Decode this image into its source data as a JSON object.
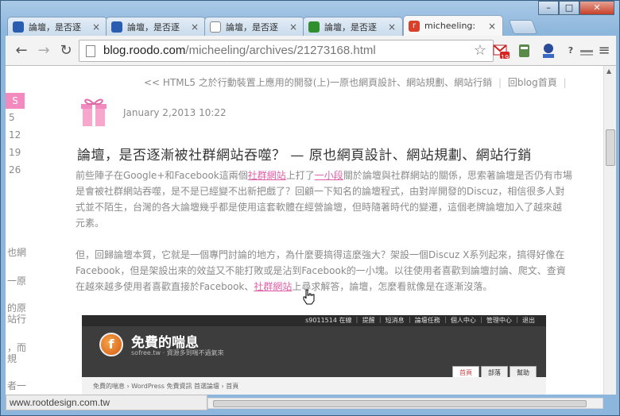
{
  "window": {
    "controls": {
      "minimize": "–",
      "maximize": "□",
      "close": "✕"
    }
  },
  "tabs": [
    {
      "title": "論壇，是否逐",
      "favicon_color": "#2a5db0",
      "favicon": "chat-icon"
    },
    {
      "title": "論壇，是否逐",
      "favicon_color": "#2a5db0",
      "favicon": "chat-icon"
    },
    {
      "title": "論壇，是否逐",
      "favicon_color": "#ffffff",
      "favicon": "page-icon"
    },
    {
      "title": "論壇，是否逐",
      "favicon_color": "#2f8f2f",
      "favicon": "sheet-icon"
    },
    {
      "title": "micheeling:",
      "favicon_color": "#d8402c",
      "favicon": "roodo-icon",
      "active": true
    }
  ],
  "tab_close_glyph": "×",
  "toolbar": {
    "back": "←",
    "forward": "→",
    "reload": "↻",
    "url_domain": "blog.roodo.com",
    "url_path": "/micheeling/archives/21273168.html",
    "star": "☆",
    "extensions": [
      {
        "name": "gmail-icon",
        "badge": "19"
      },
      {
        "name": "evernote-icon"
      },
      {
        "name": "stats-icon"
      },
      {
        "name": "help-icon",
        "glyph": "?"
      },
      {
        "name": "tool-icon"
      },
      {
        "name": "menu-icon",
        "glyph": "≡"
      }
    ]
  },
  "page": {
    "prev_post_link": "<< HTML5 之於行動裝置上應用的開發(上)一原也網頁設計、網站規劃、網站行銷",
    "separator": "|",
    "blog_home_link": "回blog首頁",
    "calendar": {
      "header": "S",
      "days": [
        "5",
        "12",
        "19",
        "26"
      ]
    },
    "left_snippets": [
      "也網",
      "一原",
      "的原",
      "站行",
      "，而",
      "規",
      "者一"
    ],
    "post_date": "January 2,2013 10:22",
    "post_title": "論壇，是否逐漸被社群網站吞噬？ — 原也網頁設計、網站規劃、網站行銷",
    "para1": {
      "l1_a": " 前些陣子在Google+和Facebook這兩個",
      "l1_link1": "社群網站",
      "l1_b": "上打了",
      "l1_link2": "一小段",
      "l1_c": "關於論壇與社群網站的關係，思索著論壇是否仍有市場",
      "l2": "是會被社群網站吞噬，是不是已經變不出新把戲了？回顧一下知名的論壇程式，由對岸開發的Discuz，相信很多人對",
      "l3": "式並不陌生，台灣的各大論壇幾乎都是使用這套軟體在經營論壇，但時隨著時代的變遷，這個老牌論壇加入了越來越",
      "l4": "元素。"
    },
    "para2": {
      "l1": "但，回歸論壇本質，它就是一個專門討論的地方，為什麼要搞得這麼強大？架設一個Discuz X系列起來，搞得好像在",
      "l2": "Facebook，但是架設出來的效益又不能打敗或是沾到Facebook的一小塊。以往使用者喜歡到論壇討論、爬文、查資",
      "l3_a": "在越來越多使用者喜歡直接於Facebook、",
      "l3_link": "社群網站",
      "l3_b": "上尋求解答，論壇，怎麼看就像是在逐漸沒落。"
    },
    "embed": {
      "topbar": "s9011514 在線 ｜ 提醒 ｜ 短消息 ｜ 論壇任務 ｜ 個人中心 ｜ 管理中心 ｜ 退出",
      "logo_glyph": "f",
      "site_title": "免費的喘息",
      "site_sub": "sofree.tw · 資源多到喘不過氣來",
      "menu": [
        "首頁",
        "部落",
        "幫助"
      ],
      "breadcrumb": "免費的喘息 › WordPress 免費資訊 首選論壇 › 首頁"
    }
  },
  "status_bar": "www.rootdesign.com.tw"
}
